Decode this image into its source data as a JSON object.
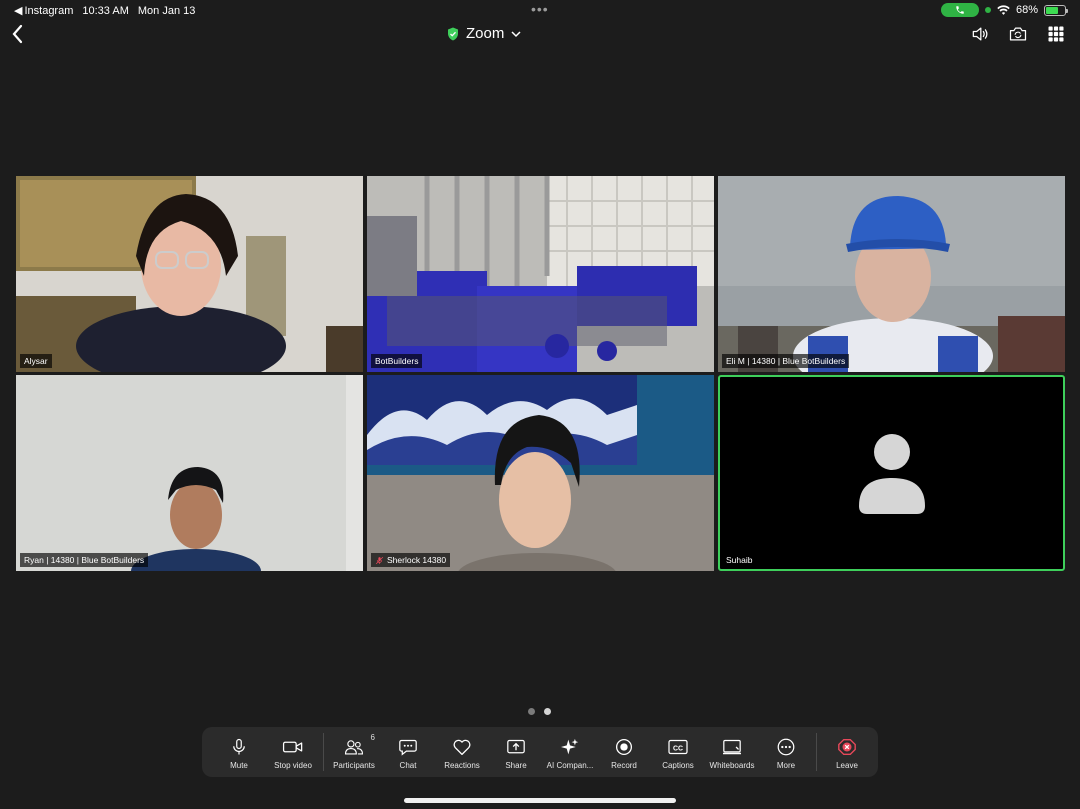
{
  "status": {
    "back_app": "Instagram",
    "time": "10:33 AM",
    "date": "Mon Jan 13",
    "battery": "68%",
    "battery_level": 0.68
  },
  "header": {
    "title": "Zoom",
    "shield_color": "#3ecf5b"
  },
  "participants": [
    {
      "name": "Alysar"
    },
    {
      "name": "BotBuilders"
    },
    {
      "name": "Eli M | 14380 | Blue BotBuilders"
    },
    {
      "name": "Ryan | 14380 | Blue BotBuilders"
    },
    {
      "name": "Sherlock 14380"
    },
    {
      "name": "Suhaib"
    }
  ],
  "toolbar": {
    "mute": "Mute",
    "stop_video": "Stop video",
    "participants": "Participants",
    "participant_count": "6",
    "chat": "Chat",
    "reactions": "Reactions",
    "share": "Share",
    "ai": "AI Compan...",
    "record": "Record",
    "captions": "Captions",
    "whiteboards": "Whiteboards",
    "more": "More",
    "leave": "Leave"
  },
  "colors": {
    "accent_green": "#3ecf5b",
    "leave_red": "#e8485a"
  }
}
